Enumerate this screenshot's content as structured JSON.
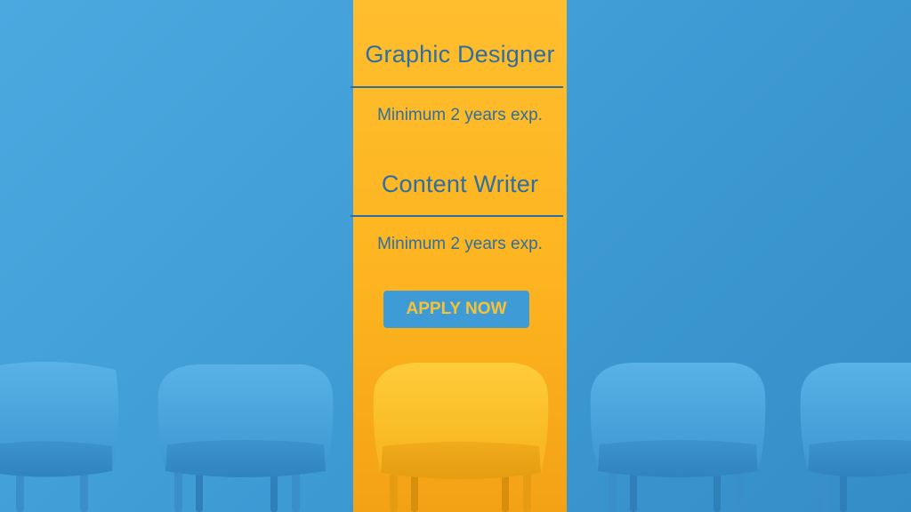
{
  "job_listing": {
    "roles": [
      {
        "title": "Graphic Designer",
        "requirement": "Minimum 2 years exp."
      },
      {
        "title": "Content Writer",
        "requirement": "Minimum 2 years exp."
      }
    ],
    "cta_label": "APPLY NOW"
  },
  "colors": {
    "background_blue": "#3e9ad3",
    "band_yellow": "#fdb420",
    "text_blue": "#2f6f9f",
    "button_blue": "#3f9bd6",
    "button_text_yellow": "#f7c236",
    "chair_blue": "#4aa5dd",
    "chair_yellow": "#ffc01e"
  }
}
